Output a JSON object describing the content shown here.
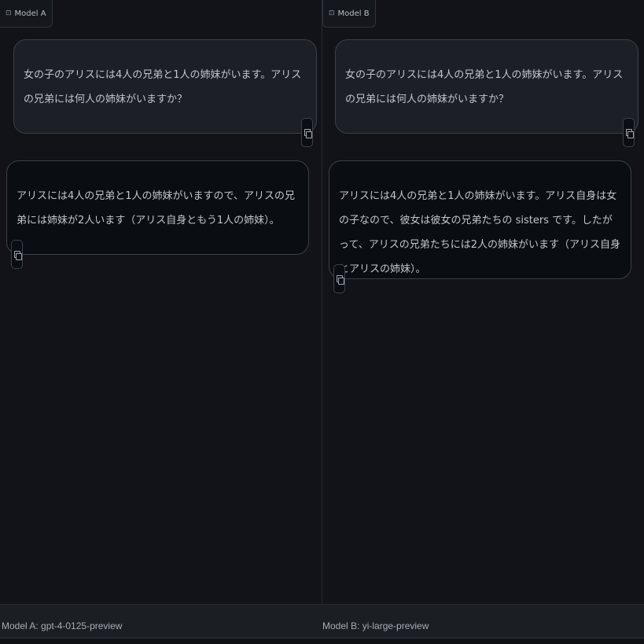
{
  "panes": {
    "a": {
      "label": "Model A",
      "user_message": "女の子のアリスには4人の兄弟と1人の姉妹がいます。アリスの兄弟には何人の姉妹がいますか？",
      "bot_message": "アリスには4人の兄弟と1人の姉妹がいますので、アリスの兄弟には姉妹が2人います（アリス自身ともう1人の姉妹）。"
    },
    "b": {
      "label": "Model B",
      "user_message": "女の子のアリスには4人の兄弟と1人の姉妹がいます。アリスの兄弟には何人の姉妹がいますか？",
      "bot_message": "アリスには4人の兄弟と1人の姉妹がいます。アリス自身は女の子なので、彼女は彼女の兄弟たちの sisters です。したがって、アリスの兄弟たちには2人の姉妹がいます（アリス自身とアリスの姉妹）。"
    }
  },
  "footer": {
    "model_a": "Model A: gpt-4-0125-preview",
    "model_b": "Model B: yi-large-preview"
  },
  "icons": {
    "pane_label": "chat-icon",
    "copy": "copy-icon"
  }
}
